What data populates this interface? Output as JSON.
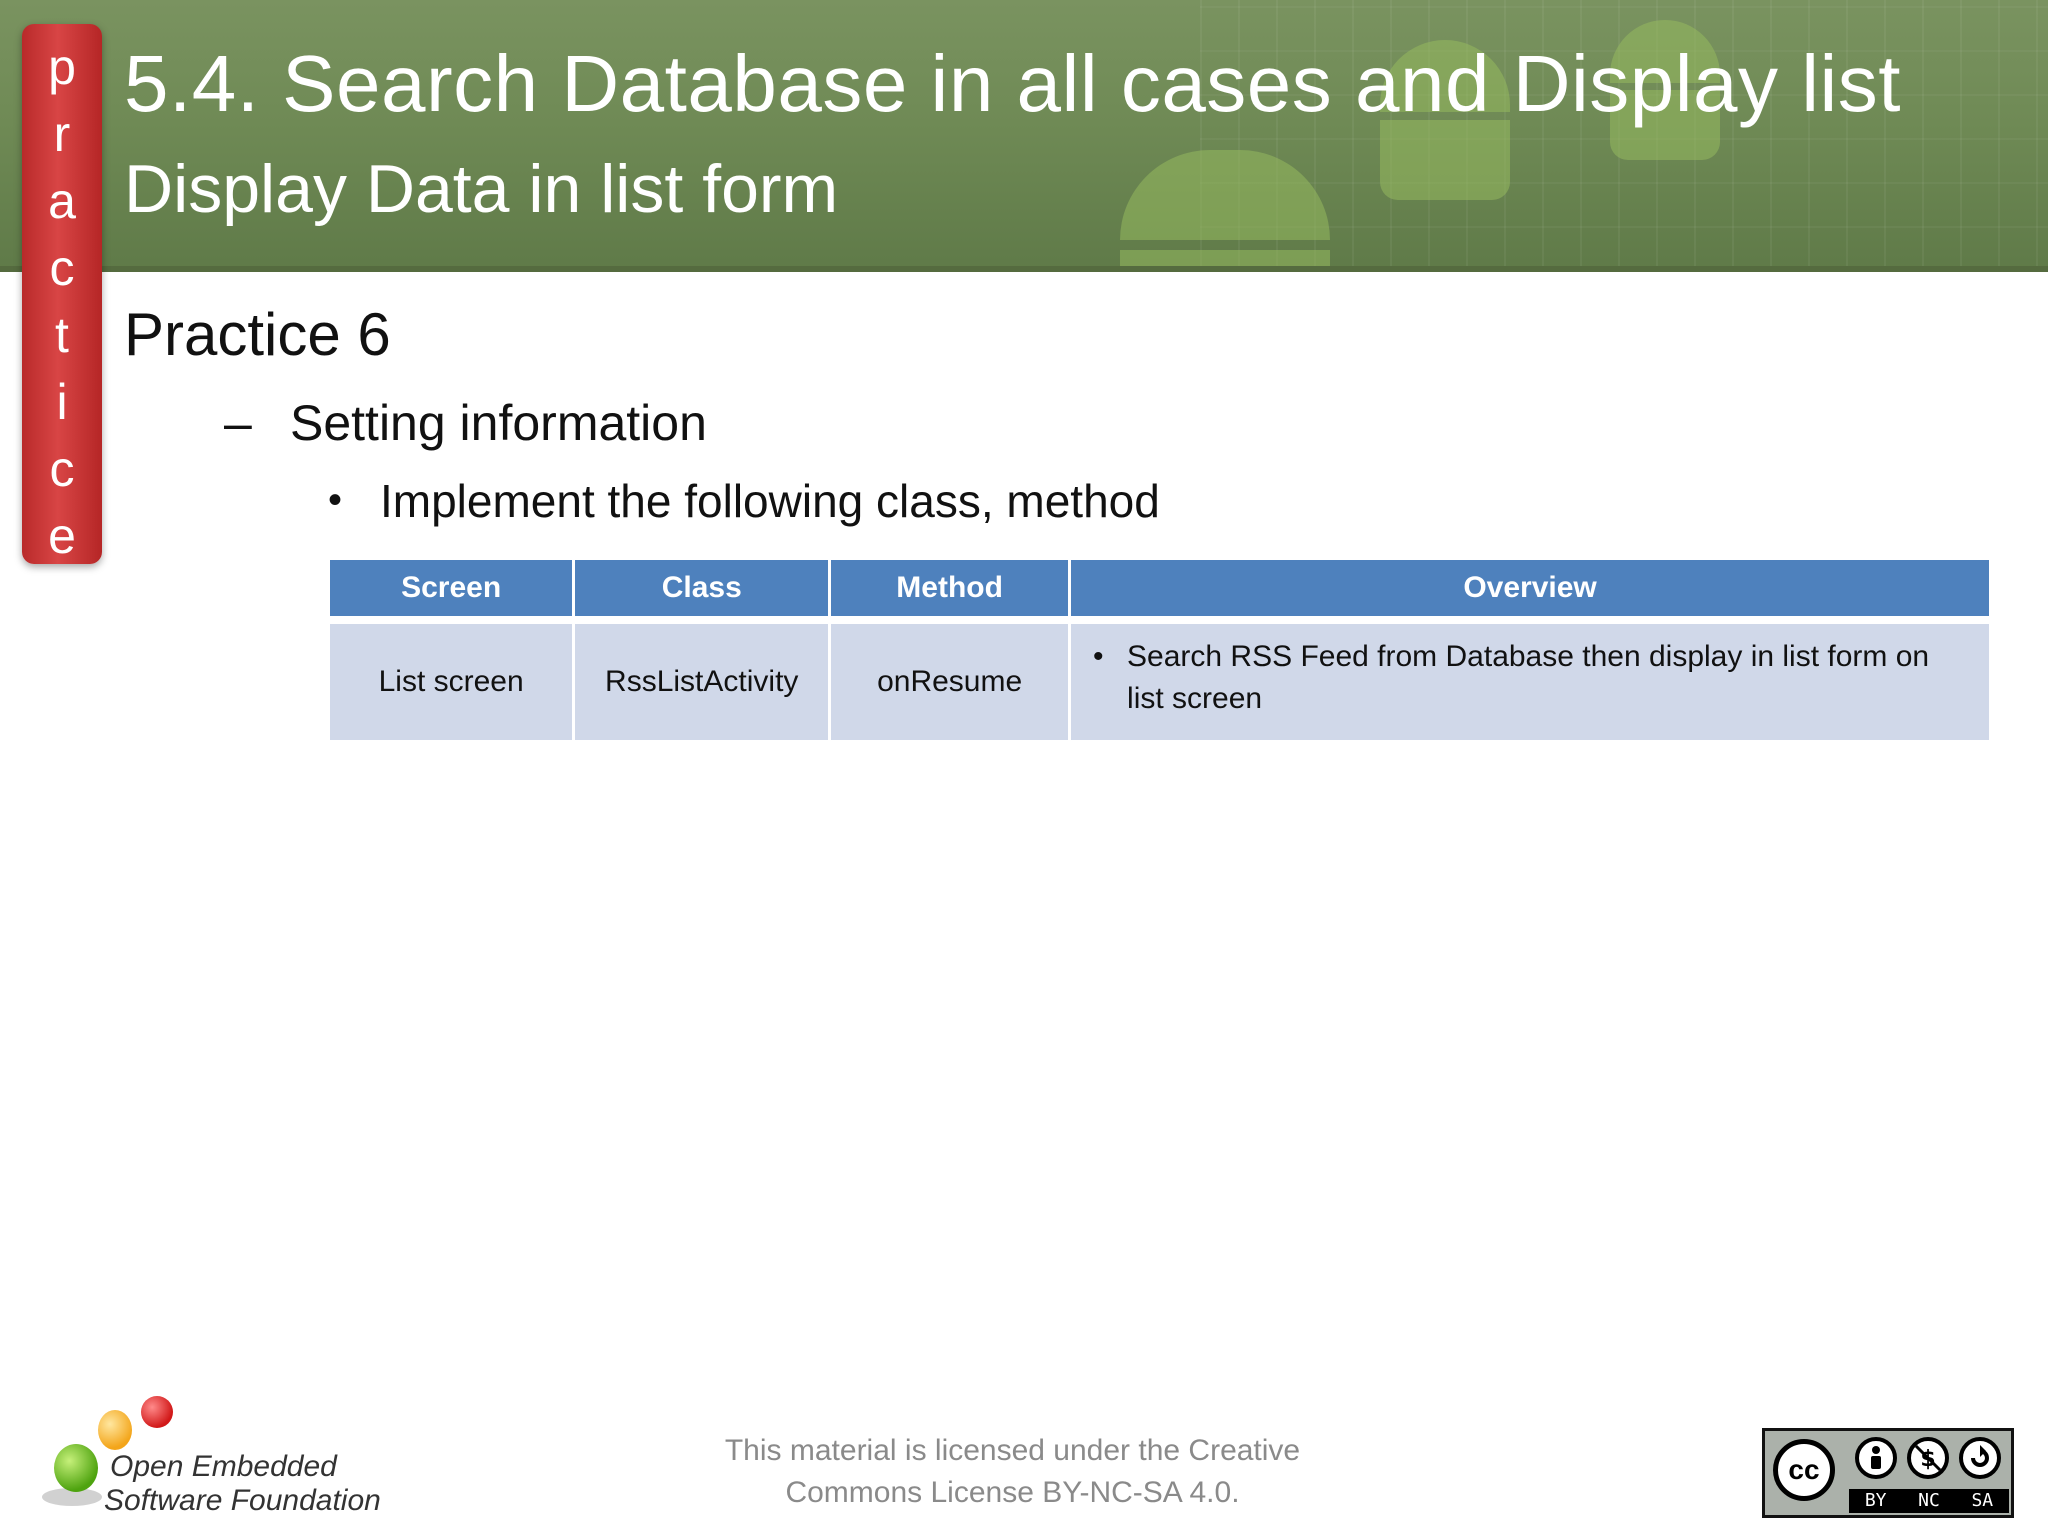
{
  "slide": {
    "title": "5.4. Search Database in all cases and Display list",
    "subtitle": "Display Data in list form",
    "side_tab_letters": [
      "p",
      "r",
      "a",
      "c",
      "t",
      "i",
      "c",
      "e"
    ]
  },
  "content": {
    "level1": "Practice 6",
    "level2_marker": "–",
    "level2": "Setting information",
    "level3_marker": "•",
    "level3": "Implement the following class, method"
  },
  "table": {
    "headers": [
      "Screen",
      "Class",
      "Method",
      "Overview"
    ],
    "rows": [
      {
        "screen": "List screen",
        "class": "RssListActivity",
        "method": "onResume",
        "overview_bullet": "•",
        "overview": "Search RSS Feed from Database then display in list form on list screen"
      }
    ]
  },
  "footer": {
    "license_line1": "This material is licensed under the Creative",
    "license_line2": "Commons License BY-NC-SA 4.0.",
    "logo_line1": "Open Embedded",
    "logo_line2": "Software Foundation",
    "cc_badge": {
      "cc": "cc",
      "labels": [
        "BY",
        "NC",
        "SA"
      ],
      "icons": [
        "attribution-icon",
        "noncommercial-icon",
        "sharealike-icon"
      ]
    }
  },
  "colors": {
    "header_green": "#6f8a55",
    "side_tab_red": "#c83232",
    "table_header_blue": "#4e81bd",
    "table_row_blue": "#d0d8e9",
    "footer_gray": "#8a8a8a"
  }
}
